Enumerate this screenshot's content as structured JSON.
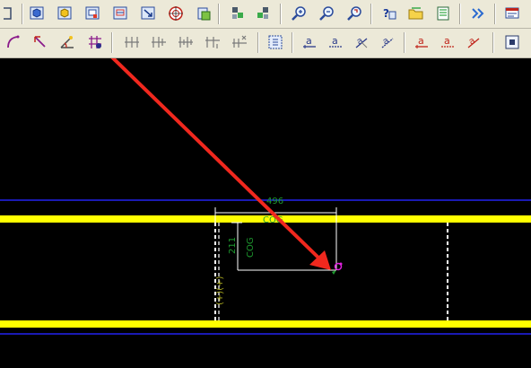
{
  "toolbar_top": {
    "buttons": [
      {
        "icon": "frame-edge-icon"
      },
      {
        "icon": "shaded-view-icon"
      },
      {
        "icon": "hidden-view-icon"
      },
      {
        "icon": "window-view-icon"
      },
      {
        "icon": "fit-view-icon"
      },
      {
        "icon": "zoom-window-icon"
      },
      {
        "icon": "target-view-icon"
      },
      {
        "icon": "paste-view-icon"
      },
      {
        "icon": "view-left-icon"
      },
      {
        "icon": "view-right-icon"
      },
      {
        "icon": "zoom-in-icon"
      },
      {
        "icon": "zoom-out-icon"
      },
      {
        "icon": "zoom-previous-icon"
      },
      {
        "icon": "help-query-icon"
      },
      {
        "icon": "open-folder-icon"
      },
      {
        "icon": "list-icon"
      },
      {
        "icon": "more-arrows-icon"
      },
      {
        "icon": "report-icon"
      }
    ]
  },
  "toolbar_bottom": {
    "buttons": [
      {
        "icon": "arc-icon"
      },
      {
        "icon": "angle-line-icon"
      },
      {
        "icon": "angle-dimension-icon"
      },
      {
        "icon": "point-tool-icon"
      },
      {
        "icon": "ticks-dimension-icon"
      },
      {
        "icon": "ticks-dimension-2-icon"
      },
      {
        "icon": "ticks-dimension-3-icon"
      },
      {
        "icon": "ticks-dimension-4-icon"
      },
      {
        "icon": "ticks-dimension-5-icon"
      },
      {
        "icon": "select-area-icon"
      },
      {
        "icon": "text-mark-icon"
      },
      {
        "icon": "text-mark-2-icon"
      },
      {
        "icon": "text-mark-3-icon"
      },
      {
        "icon": "text-mark-4-icon"
      },
      {
        "icon": "text-mark-red-icon"
      },
      {
        "icon": "text-mark-red-2-icon"
      },
      {
        "icon": "text-mark-red-3-icon"
      },
      {
        "icon": "snap-icon"
      }
    ]
  },
  "drawing": {
    "horizontal_dimension": "496",
    "vertical_dimension": "211",
    "cog_label_top": "COG",
    "cog_label_vertical": "COG",
    "left_text_vertical": "(+)(+)",
    "colors": {
      "beam_yellow": "#ffff00",
      "blue_line": "#1a1ab4",
      "dim_green": "#1e9b2f",
      "annotation_red": "#f0281e",
      "cog_magenta": "#e020e0"
    }
  }
}
